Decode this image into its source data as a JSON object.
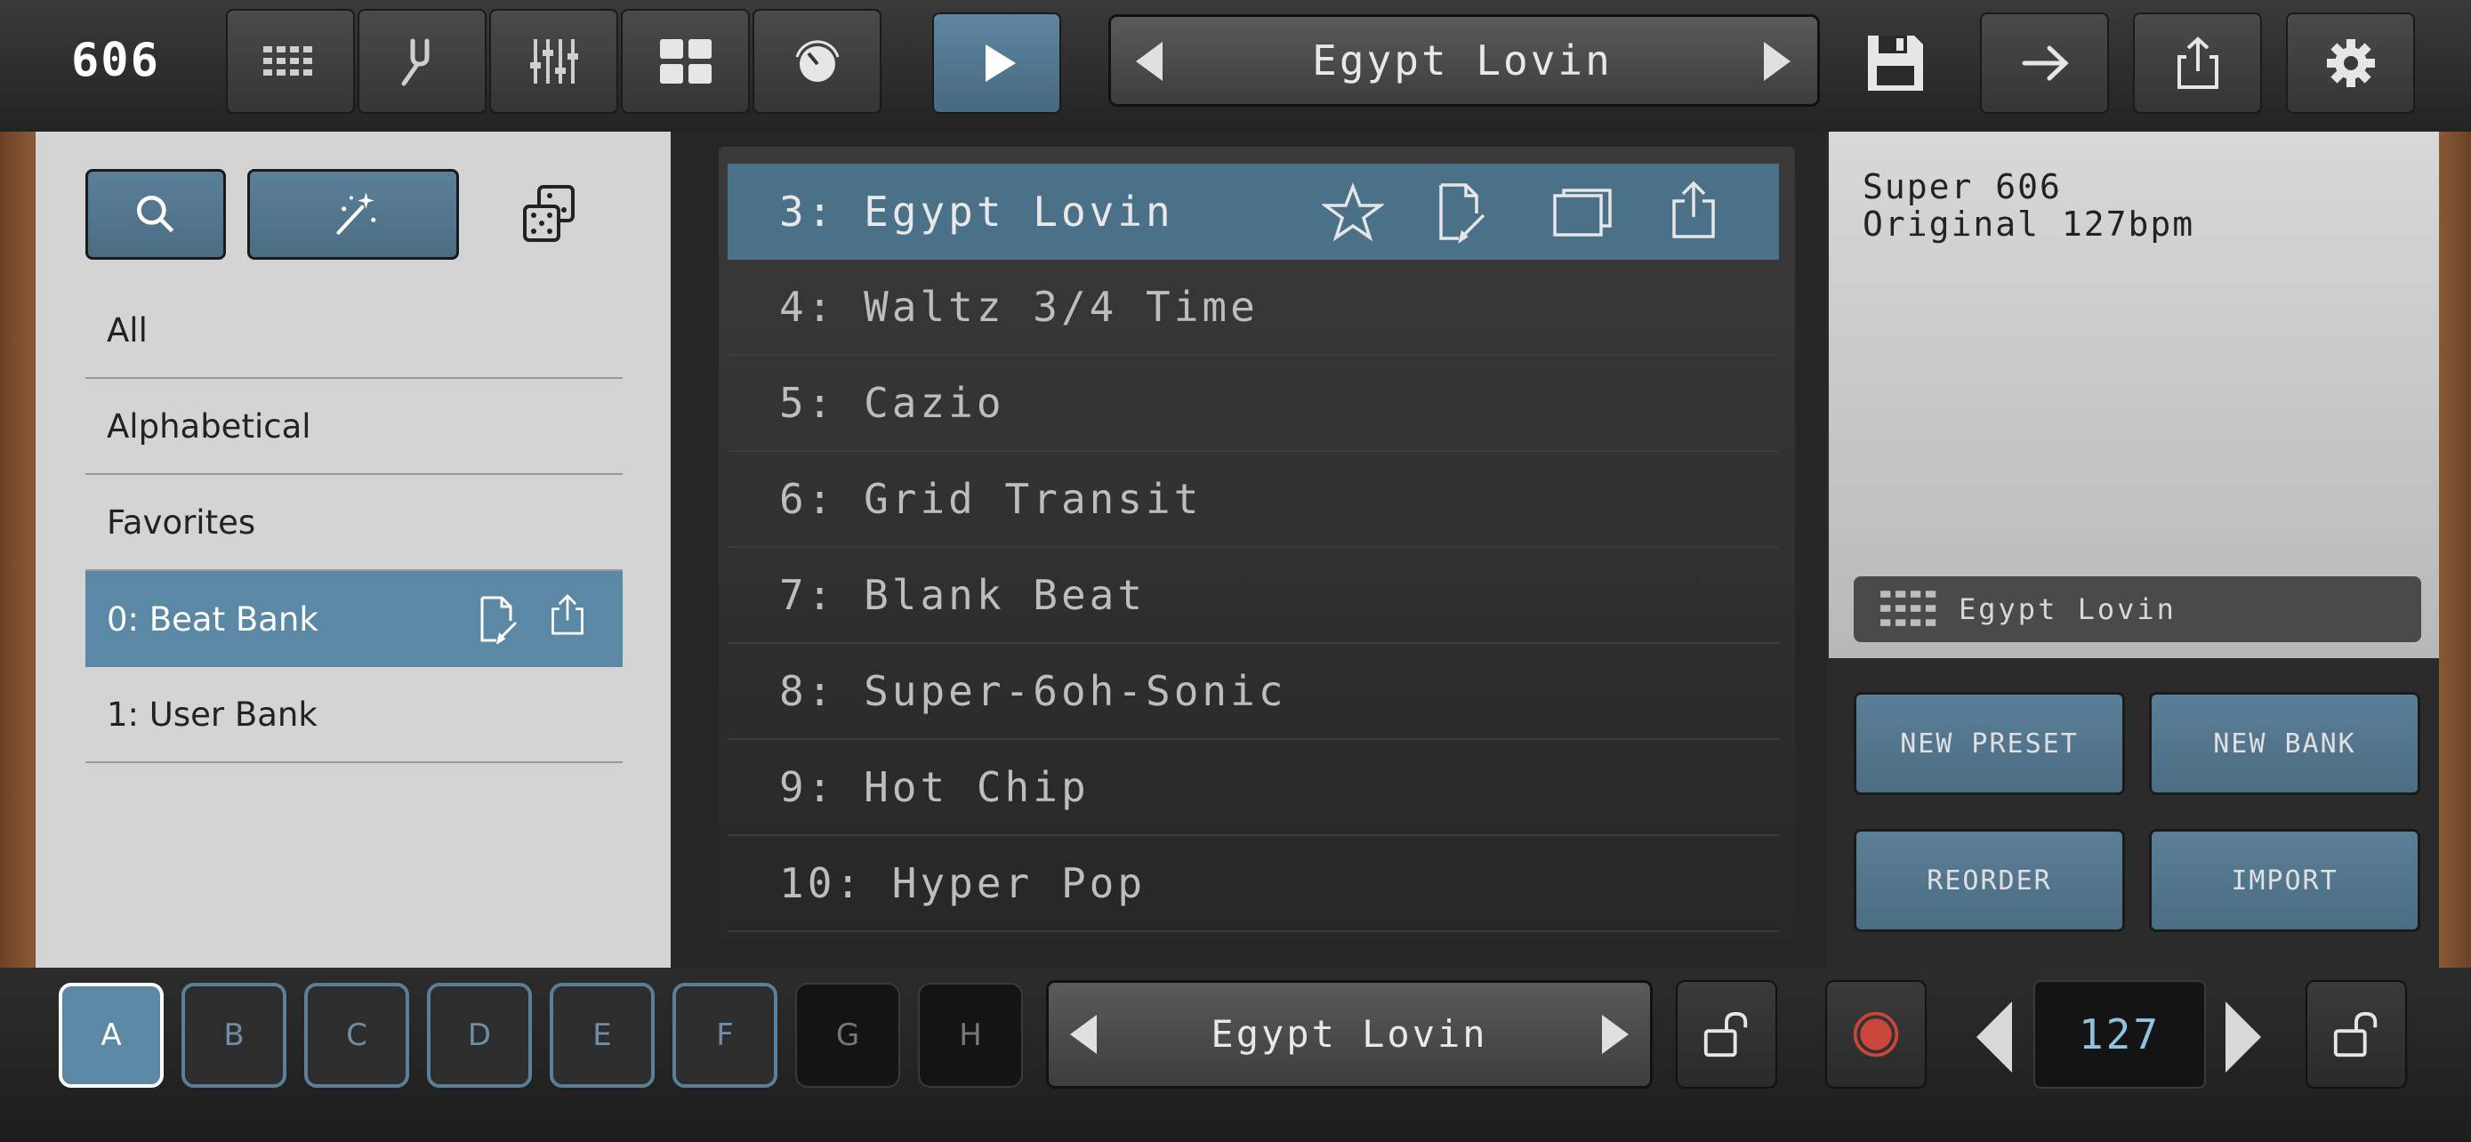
{
  "app": {
    "logo": "606"
  },
  "header": {
    "preset_name": "Egypt Lovin",
    "toolbar_icons": [
      "sequencer-icon",
      "tuning-fork-icon",
      "mixer-icon",
      "grid-icon",
      "knob-icon"
    ]
  },
  "sidebar": {
    "categories": [
      {
        "label": "All"
      },
      {
        "label": "Alphabetical"
      },
      {
        "label": "Favorites"
      },
      {
        "label": "0: Beat Bank"
      },
      {
        "label": "1: User Bank"
      }
    ]
  },
  "presets": {
    "items": [
      {
        "label": "3: Egypt Lovin"
      },
      {
        "label": "4: Waltz 3/4 Time"
      },
      {
        "label": "5: Cazio"
      },
      {
        "label": "6: Grid Transit"
      },
      {
        "label": "7: Blank Beat"
      },
      {
        "label": "8: Super-6oh-Sonic"
      },
      {
        "label": "9: Hot Chip"
      },
      {
        "label": "10: Hyper Pop"
      }
    ]
  },
  "info": {
    "line1": "Super 606",
    "line2": "Original 127bpm",
    "pattern_name": "Egypt Lovin"
  },
  "actions": {
    "new_preset": "NEW PRESET",
    "new_bank": "NEW BANK",
    "reorder": "REORDER",
    "import": "IMPORT"
  },
  "bottom": {
    "slots": [
      "A",
      "B",
      "C",
      "D",
      "E",
      "F",
      "G",
      "H"
    ],
    "pattern_name": "Egypt Lovin",
    "tempo": "127"
  },
  "colors": {
    "accent": "#5b88a5",
    "selected_row": "#4b7189",
    "record": "#c8463a"
  }
}
